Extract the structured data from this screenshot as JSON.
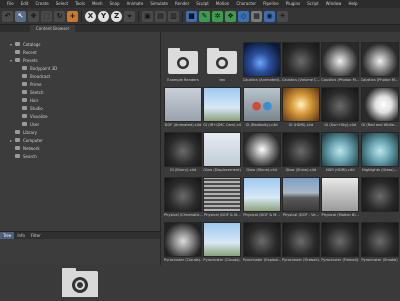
{
  "menubar": {
    "items": [
      "File",
      "Edit",
      "Create",
      "Select",
      "Tools",
      "Mesh",
      "Snap",
      "Animate",
      "Simulate",
      "Render",
      "Sculpt",
      "Motion",
      "Character",
      "Pipeline",
      "Plugins",
      "Script",
      "Window",
      "Help"
    ]
  },
  "toolbar": {
    "axis_x": "X",
    "axis_y": "Y",
    "axis_z": "Z"
  },
  "panel": {
    "title": "Content Browser"
  },
  "sidebar": {
    "items": [
      {
        "label": "Catalogs",
        "level": 0,
        "arrow": "▾"
      },
      {
        "label": "Recent",
        "level": 0,
        "arrow": ""
      },
      {
        "label": "Presets",
        "level": 0,
        "arrow": "▾"
      },
      {
        "label": "Bodypaint 3D",
        "level": 1,
        "arrow": ""
      },
      {
        "label": "Broadcast",
        "level": 1,
        "arrow": ""
      },
      {
        "label": "Prime",
        "level": 1,
        "arrow": ""
      },
      {
        "label": "Sketch",
        "level": 1,
        "arrow": ""
      },
      {
        "label": "Hair",
        "level": 1,
        "arrow": ""
      },
      {
        "label": "Studio",
        "level": 1,
        "arrow": ""
      },
      {
        "label": "Visualize",
        "level": 1,
        "arrow": ""
      },
      {
        "label": "User",
        "level": 1,
        "arrow": ""
      },
      {
        "label": "Library",
        "level": 0,
        "arrow": ""
      },
      {
        "label": "Computer",
        "level": 0,
        "arrow": "▸"
      },
      {
        "label": "Network",
        "level": 0,
        "arrow": ""
      },
      {
        "label": "Search",
        "level": 0,
        "arrow": ""
      }
    ],
    "tabs": [
      "Tree",
      "Info",
      "Filter"
    ]
  },
  "grid": {
    "items": [
      {
        "label": "Example Renders",
        "kind": "folder"
      },
      {
        "label": "tex",
        "kind": "folder"
      },
      {
        "label": "Caustics (Animated)...",
        "kind": "blue"
      },
      {
        "label": "Caustics (Volume C...",
        "kind": "dark"
      },
      {
        "label": "Caustics (Photon M...",
        "kind": "orb"
      },
      {
        "label": "Caustics (Photon M...",
        "kind": "orb"
      },
      {
        "label": "DOF (Animated).c4d",
        "kind": "figure"
      },
      {
        "label": "GI (IR+QMC Cam).c4d",
        "kind": "sky"
      },
      {
        "label": "GI (Radiosity).c4d",
        "kind": "balls"
      },
      {
        "label": "GI (HDRI).c4d",
        "kind": "warm"
      },
      {
        "label": "GI (Sun+Sky).c4d",
        "kind": "dark"
      },
      {
        "label": "GI (Red and White...",
        "kind": "white"
      },
      {
        "label": "GI (Blurry).c4d",
        "kind": "dark"
      },
      {
        "label": "Glow (Displacement)...",
        "kind": "light"
      },
      {
        "label": "Glow (Shine).c4d",
        "kind": "chrome"
      },
      {
        "label": "Glow (Shine).c4d",
        "kind": "dark"
      },
      {
        "label": "HDR (HDRI).c4d",
        "kind": "teal"
      },
      {
        "label": "Highlights (Glass)...",
        "kind": "teal"
      },
      {
        "label": "Physical (Chromatic...",
        "kind": "dark"
      },
      {
        "label": "Physical (DOF & M...",
        "kind": "spring"
      },
      {
        "label": "Physical (DOF & M...",
        "kind": "sky"
      },
      {
        "label": "Physical (DOF - Ve...",
        "kind": "road"
      },
      {
        "label": "Physical (Motion Bl...",
        "kind": "arch"
      },
      {
        "label": "",
        "kind": "dark"
      },
      {
        "label": "Pyrocluster (Clouds)...",
        "kind": "cloud"
      },
      {
        "label": "Pyrocluster (Clouds)...",
        "kind": "sky"
      },
      {
        "label": "Pyrocluster (Explosi...",
        "kind": "dark"
      },
      {
        "label": "Pyrocluster (Fireball)...",
        "kind": "dark"
      },
      {
        "label": "Pyrocluster (Fireball)...",
        "kind": "dark"
      },
      {
        "label": "Pyrocluster (Smoke)",
        "kind": "dark"
      },
      {
        "label": "",
        "kind": "dark"
      },
      {
        "label": "",
        "kind": "gold"
      },
      {
        "label": "",
        "kind": "sky"
      },
      {
        "label": "",
        "kind": "dark"
      },
      {
        "label": "",
        "kind": "dark"
      },
      {
        "label": "",
        "kind": "dark"
      }
    ]
  },
  "colors": {
    "accent": "#4e5f7e",
    "background": "#3a3a3a"
  }
}
